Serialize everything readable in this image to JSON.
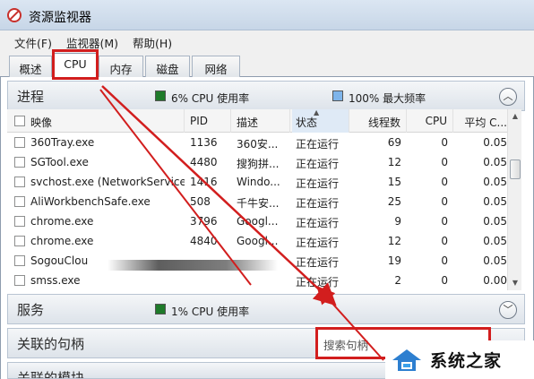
{
  "window": {
    "title": "资源监视器"
  },
  "menu": [
    "文件(F)",
    "监视器(M)",
    "帮助(H)"
  ],
  "tabs": [
    "概述",
    "CPU",
    "内存",
    "磁盘",
    "网络"
  ],
  "active_tab": "CPU",
  "processes": {
    "title": "进程",
    "cpu_usage": "6% CPU 使用率",
    "max_freq": "100% 最大频率",
    "columns": [
      "映像",
      "PID",
      "描述",
      "状态",
      "线程数",
      "CPU",
      "平均 C..."
    ],
    "rows": [
      {
        "image": "360Tray.exe",
        "pid": "1136",
        "desc": "360安...",
        "status": "正在运行",
        "threads": "69",
        "cpu": "0",
        "avg": "0.05"
      },
      {
        "image": "SGTool.exe",
        "pid": "4480",
        "desc": "搜狗拼...",
        "status": "正在运行",
        "threads": "12",
        "cpu": "0",
        "avg": "0.05"
      },
      {
        "image": "svchost.exe (NetworkService)",
        "pid": "1416",
        "desc": "Windo...",
        "status": "正在运行",
        "threads": "15",
        "cpu": "0",
        "avg": "0.05"
      },
      {
        "image": "AliWorkbenchSafe.exe",
        "pid": "508",
        "desc": "千牛安...",
        "status": "正在运行",
        "threads": "25",
        "cpu": "0",
        "avg": "0.05"
      },
      {
        "image": "chrome.exe",
        "pid": "3796",
        "desc": "Googl...",
        "status": "正在运行",
        "threads": "9",
        "cpu": "0",
        "avg": "0.05"
      },
      {
        "image": "chrome.exe",
        "pid": "4840",
        "desc": "Googl...",
        "status": "正在运行",
        "threads": "12",
        "cpu": "0",
        "avg": "0.05"
      },
      {
        "image": "SogouClou",
        "pid": "",
        "desc": "",
        "status": "正在运行",
        "threads": "19",
        "cpu": "0",
        "avg": "0.05"
      },
      {
        "image": "smss.exe",
        "pid": "",
        "desc": "",
        "status": "正在运行",
        "threads": "2",
        "cpu": "0",
        "avg": "0.00"
      }
    ]
  },
  "services": {
    "title": "服务",
    "cpu_usage": "1% CPU 使用率"
  },
  "handles": {
    "title": "关联的句柄",
    "search_placeholder": "搜索句柄"
  },
  "modules": {
    "title": "关联的模块"
  },
  "watermark": {
    "text": "系统之家"
  },
  "colors": {
    "accent_red": "#d21e1e",
    "cpu_green": "#1e7a2a",
    "freq_blue": "#7eb4ea"
  }
}
